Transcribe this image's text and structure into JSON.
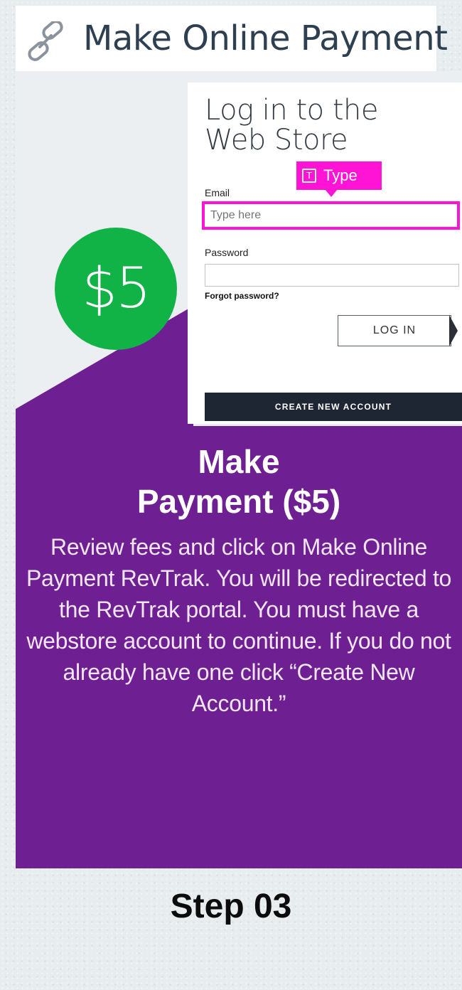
{
  "header": {
    "title": "Make Online Payment",
    "icon": "link-icon"
  },
  "price_badge": {
    "label": "$5",
    "color": "#11b347"
  },
  "login_panel": {
    "title_line1": "Log in to the",
    "title_line2": "Web Store",
    "type_tag": {
      "icon_letter": "T",
      "label": "Type",
      "color": "#ff14d6"
    },
    "email_label": "Email",
    "email_placeholder": "Type here",
    "password_label": "Password",
    "forgot_password": "Forgot password?",
    "login_button": "LOG IN",
    "create_account_button": "CREATE NEW ACCOUNT"
  },
  "step": {
    "heading_line1": "Make",
    "heading_line2": "Payment ($5)",
    "description": "Review fees and click on Make Online Payment RevTrak. You will be redirected to the RevTrak portal. You must have a webstore account to continue. If you do not already have one click “Create New Account.”",
    "label": "Step 03",
    "accent_color": "#6e1f92"
  }
}
